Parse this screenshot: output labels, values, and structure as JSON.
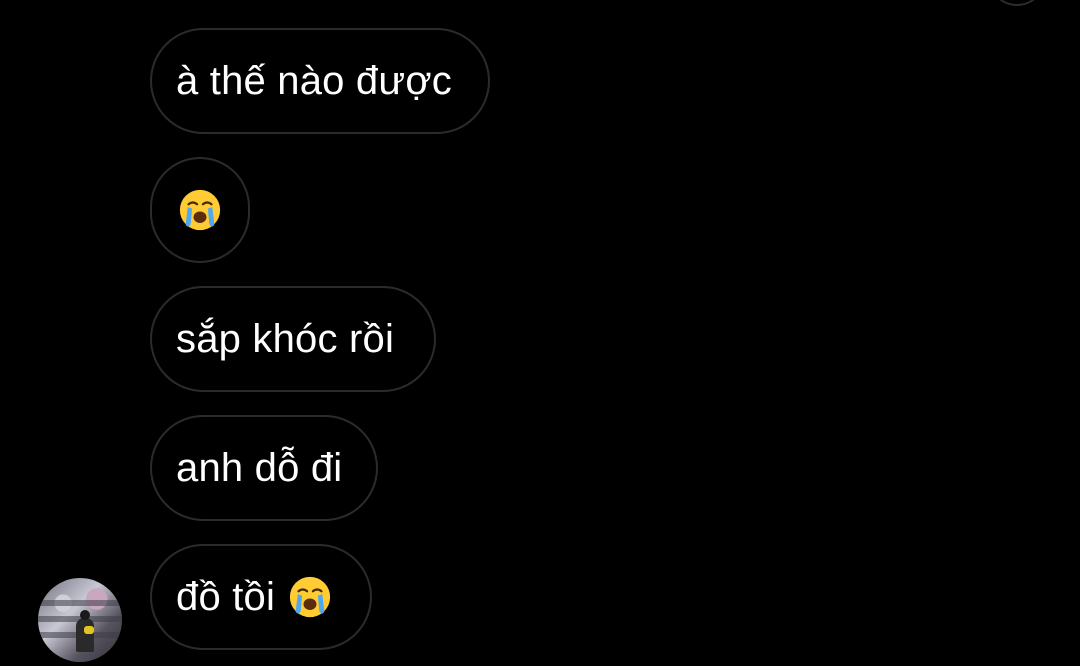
{
  "messages": [
    {
      "text": "à thế nào được",
      "emoji": null
    },
    {
      "text": "",
      "emoji": "loudly-crying-face"
    },
    {
      "text": "sắp khóc rồi",
      "emoji": null
    },
    {
      "text": "anh dỗ đi",
      "emoji": null
    },
    {
      "text": "đồ tồi",
      "emoji": "loudly-crying-face"
    }
  ],
  "colors": {
    "background": "#000000",
    "bubble_border": "#2b2b2b",
    "text": "#ffffff",
    "emoji_face": "#ffcc33",
    "emoji_tears": "#4fa8f0"
  }
}
